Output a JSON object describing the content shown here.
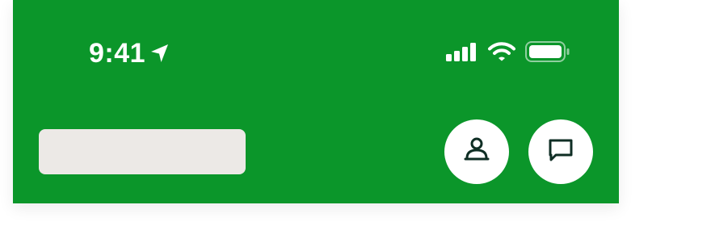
{
  "status_bar": {
    "time": "9:41",
    "icons": {
      "location": "location-arrow-icon",
      "signal": "cellular-signal-icon",
      "wifi": "wifi-icon",
      "battery": "battery-icon"
    }
  },
  "toolbar": {
    "account_icon": "person-icon",
    "messages_icon": "chat-bubble-icon"
  },
  "colors": {
    "header_background": "#0b962a",
    "placeholder_bar": "#ece9e6",
    "button_background": "#ffffff",
    "icon_dark": "#0f2e24",
    "status_foreground": "#ffffff"
  }
}
